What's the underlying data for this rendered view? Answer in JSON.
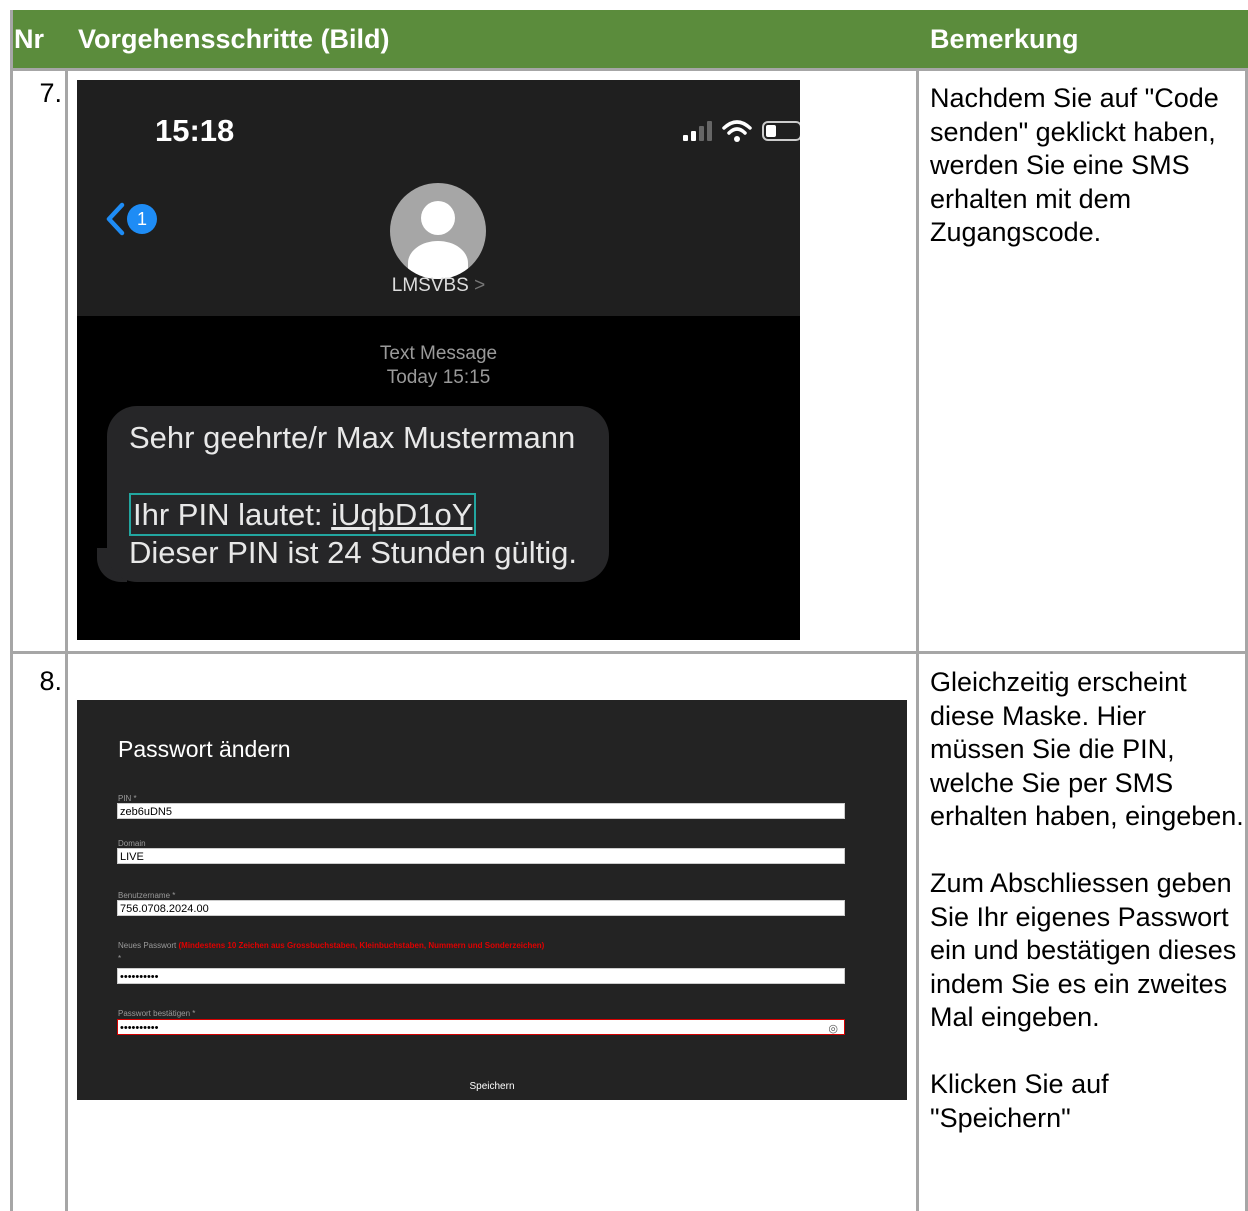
{
  "header": {
    "nr": "Nr",
    "steps": "Vorgehensschritte (Bild)",
    "remark": "Bemerkung"
  },
  "rows": [
    {
      "nr": "7.",
      "remark": [
        "Nachdem Sie auf \"Code senden\" geklickt haben, werden Sie eine SMS erhalten mit dem Zugangscode."
      ]
    },
    {
      "nr": "8.",
      "remark": [
        "Gleichzeitig erscheint diese Maske. Hier müssen Sie die PIN, welche Sie per SMS erhalten haben, eingeben.",
        "Zum Abschliessen geben Sie Ihr eigenes Passwort ein und bestätigen dieses indem Sie es ein zweites Mal eingeben.",
        "Klicken Sie auf \"Speichern\""
      ]
    }
  ],
  "phone": {
    "time": "15:18",
    "badge": "1",
    "contact": "LMSVBS",
    "contact_chevron": ">",
    "meta_type": "Text Message",
    "meta_time": "Today 15:15",
    "line1": "Sehr geehrte/r Max Mustermann",
    "pin_prefix": "Ihr PIN lautet: ",
    "pin": "iUqbD1oY",
    "line3": "Dieser PIN ist 24 Stunden gültig.",
    "icons": [
      "signal-icon",
      "wifi-icon",
      "battery-icon",
      "back-chevron-icon",
      "avatar-icon"
    ]
  },
  "form": {
    "title": "Passwort ändern",
    "pin_label": "PIN *",
    "pin_value": "zeb6uDN5",
    "domain_label": "Domain",
    "domain_value": "LIVE",
    "user_label": "Benutzername *",
    "user_value": "756.0708.2024.00",
    "newpw_label": "Neues Passwort",
    "newpw_hint": "(Mindestens 10 Zeichen aus Grossbuchstaben, Kleinbuchstaben, Nummern und Sonderzeichen)",
    "newpw_star": "*",
    "newpw_value": "••••••••••",
    "confirm_label": "Passwort bestätigen *",
    "confirm_value": "••••••••••",
    "save_label": "Speichern",
    "accent_error": "#d40000"
  },
  "colors": {
    "header_bg": "#5b8c3c",
    "grid": "#a6a6a6"
  }
}
